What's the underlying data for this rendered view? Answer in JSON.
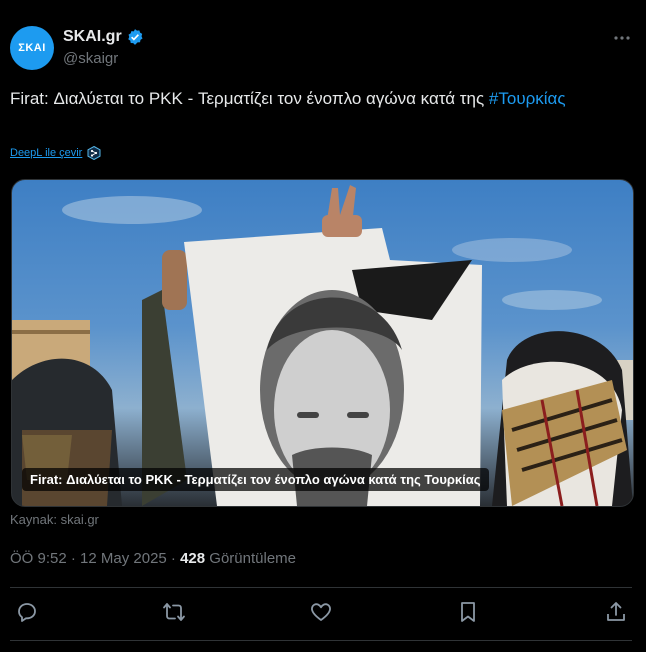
{
  "account": {
    "avatar_text": "ΣΚΑΙ",
    "display_name": "SKAI.gr",
    "handle": "@skaigr",
    "verified": true
  },
  "tweet": {
    "text": "Firat: Διαλύεται το PKK - Τερματίζει τον ένοπλο αγώνα κατά της ",
    "hashtag": "#Τουρκίας",
    "translate_label": "DeepL ile çevir"
  },
  "media": {
    "caption": "Firat: Διαλύεται το PKK - Τερματίζει τον ένοπλο αγώνα κατά της Τουρκίας"
  },
  "source": {
    "label": "Kaynak: skai.gr"
  },
  "meta": {
    "time": "ÖÖ 9:52 · 12 May 2025 · ",
    "views": "428",
    "views_label": " Görüntüleme"
  },
  "actions": {
    "icons": [
      "reply-icon",
      "retweet-icon",
      "like-icon",
      "bookmark-icon",
      "share-icon"
    ]
  },
  "colors": {
    "background": "#000000",
    "text": "#e7e9ea",
    "muted": "#71767b",
    "accent": "#1d9bf0",
    "divider": "#2f3336"
  }
}
